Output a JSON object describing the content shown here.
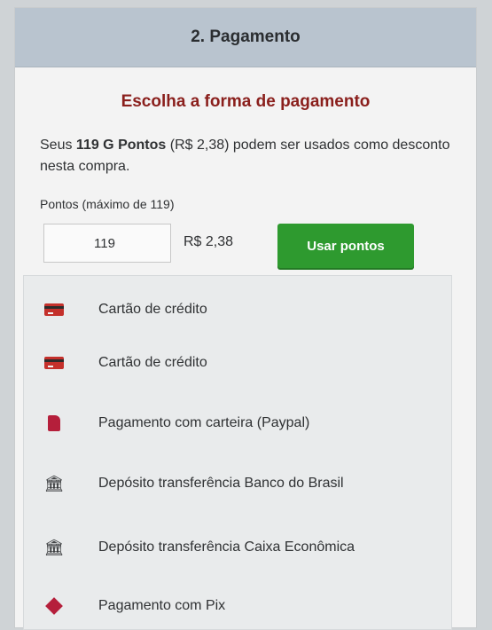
{
  "header": {
    "title": "2. Pagamento"
  },
  "subtitle": "Escolha a forma de pagamento",
  "desc": {
    "prefix": "Seus ",
    "bold": "119 G Pontos",
    "suffix": " (R$ 2,38) podem ser usados como desconto nesta compra."
  },
  "points": {
    "label": "Pontos (máximo de 119)",
    "input_value": "119",
    "value_text": "R$ 2,38",
    "button_label": "Usar pontos"
  },
  "methods": [
    {
      "label": "Cartão de crédito",
      "icon": "credit-card-icon"
    },
    {
      "label": "Cartão de crédito",
      "icon": "credit-card-icon"
    },
    {
      "label": "Pagamento com carteira (Paypal)",
      "icon": "paypal-icon"
    },
    {
      "label": "Depósito transferência Banco do Brasil",
      "icon": "bank-icon"
    },
    {
      "label": "Depósito transferência Caixa Econômica",
      "icon": "bank-icon"
    },
    {
      "label": "Pagamento com Pix",
      "icon": "pix-icon"
    }
  ],
  "colors": {
    "accent_title": "#8a1f1c",
    "button_green": "#2e9a2f",
    "header_bg": "#b9c4cf"
  }
}
